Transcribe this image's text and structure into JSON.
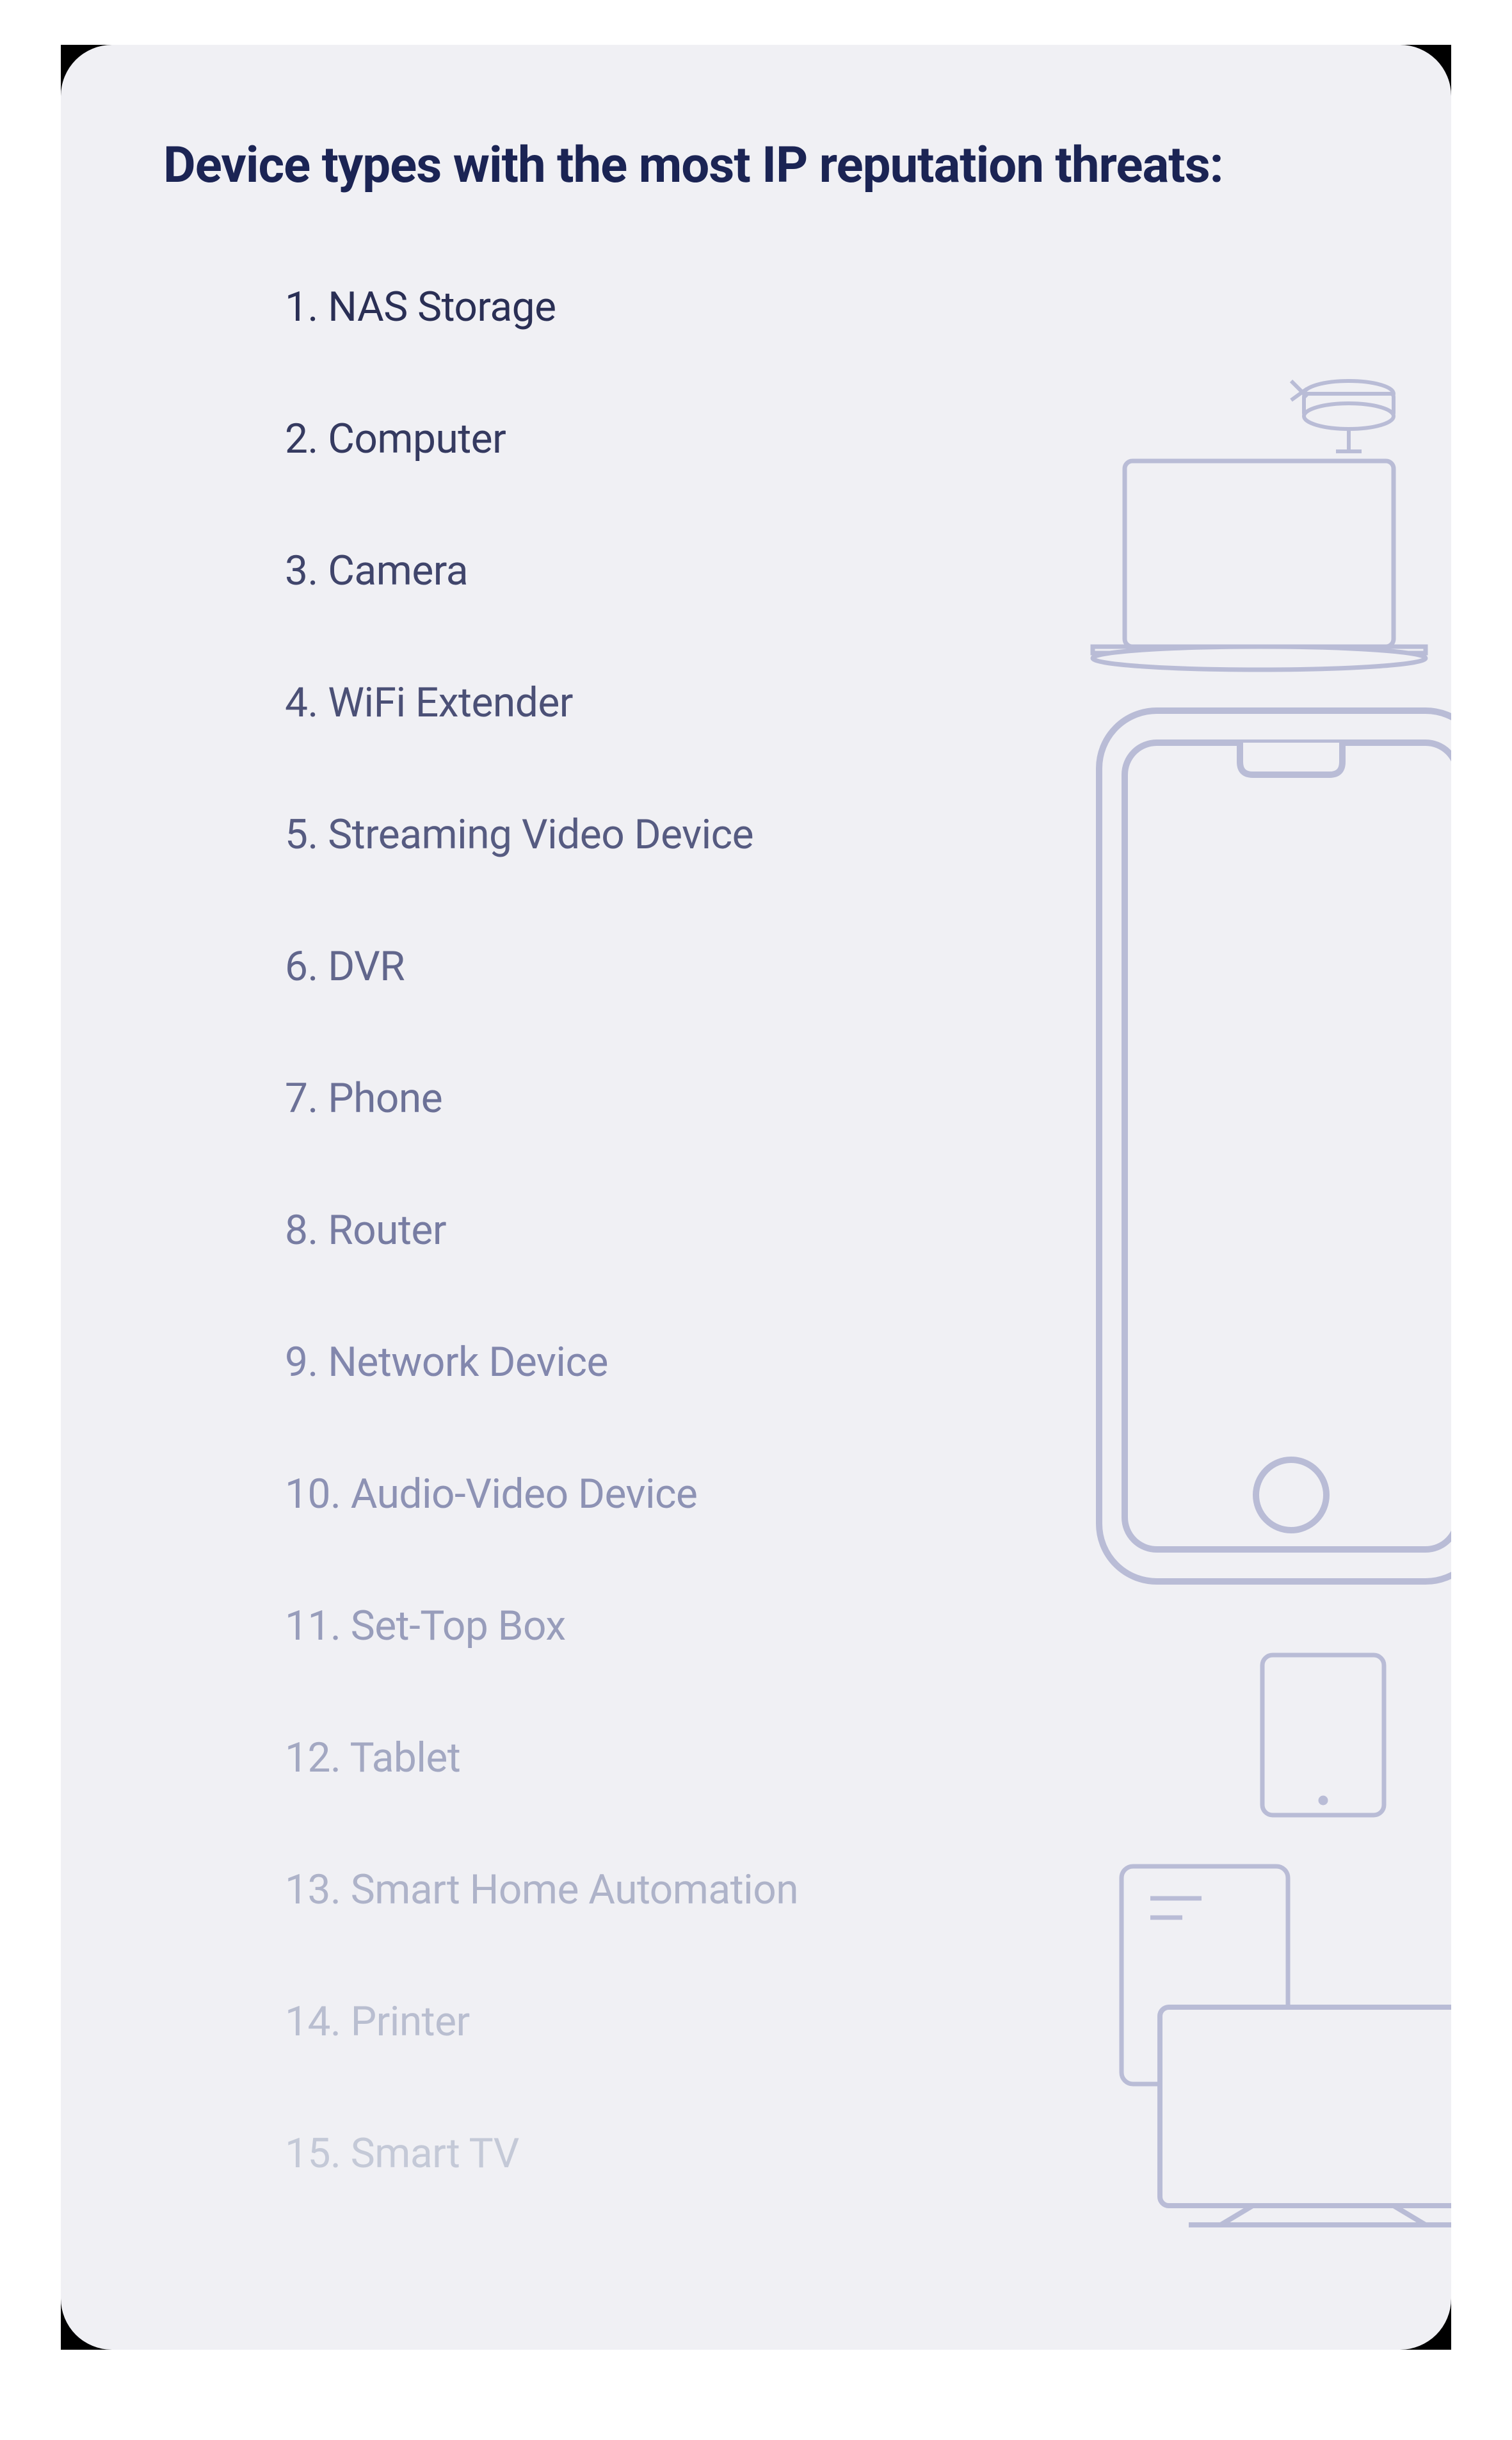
{
  "title": "Device types with the most IP reputation threats:",
  "colors": {
    "title": "#1b2454",
    "fadeStart": "#2a2f55",
    "fadeEnd": "#c4c9d7",
    "background": "#f0f0f4",
    "illustrationStroke": "#b9bcd6"
  },
  "devices": [
    {
      "rank": 1,
      "name": "NAS Storage"
    },
    {
      "rank": 2,
      "name": "Computer"
    },
    {
      "rank": 3,
      "name": "Camera"
    },
    {
      "rank": 4,
      "name": "WiFi Extender"
    },
    {
      "rank": 5,
      "name": "Streaming Video Device"
    },
    {
      "rank": 6,
      "name": "DVR"
    },
    {
      "rank": 7,
      "name": "Phone"
    },
    {
      "rank": 8,
      "name": "Router"
    },
    {
      "rank": 9,
      "name": "Network Device"
    },
    {
      "rank": 10,
      "name": "Audio-Video Device"
    },
    {
      "rank": 11,
      "name": "Set-Top Box"
    },
    {
      "rank": 12,
      "name": "Tablet"
    },
    {
      "rank": 13,
      "name": "Smart Home Automation"
    },
    {
      "rank": 14,
      "name": "Printer"
    },
    {
      "rank": 15,
      "name": "Smart TV"
    }
  ],
  "illustrations": [
    "security-camera-icon",
    "laptop-icon",
    "smartphone-icon",
    "tablet-icon",
    "printer-icon",
    "tv-icon"
  ]
}
